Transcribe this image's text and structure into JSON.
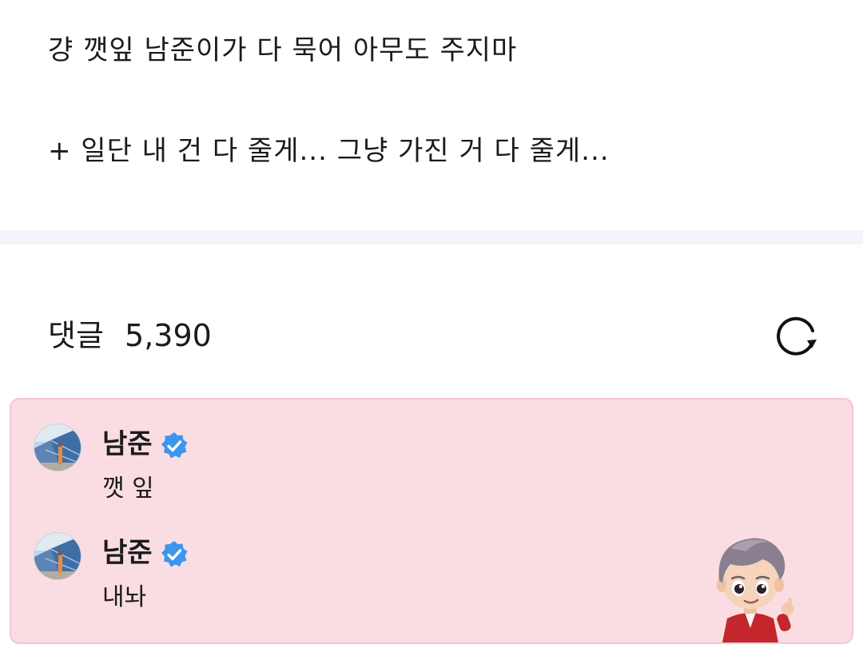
{
  "post": {
    "line1": "걍 깻잎 남준이가 다 묵어 아무도 주지마",
    "line2": "+ 일단 내 건 다 줄게... 그냥 가진 거 다 줄게..."
  },
  "comments_section": {
    "title": "댓글",
    "count": "5,390",
    "refresh_icon": "refresh-icon"
  },
  "comments": [
    {
      "author": "남준",
      "verified_icon": "verified-badge-icon",
      "text": "깻 잎"
    },
    {
      "author": "남준",
      "verified_icon": "verified-badge-icon",
      "text": "내놔"
    }
  ],
  "colors": {
    "highlight_bg": "#fadde3",
    "highlight_border": "#f3c7d0",
    "verified_blue": "#3d95ee",
    "divider": "#f4f5fa"
  }
}
